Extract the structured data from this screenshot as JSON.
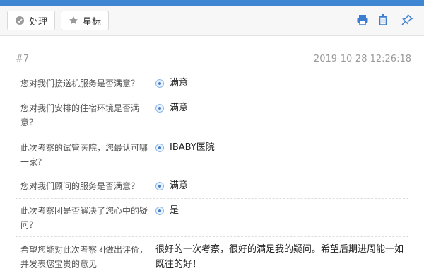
{
  "toolbar": {
    "handle_label": "处理",
    "star_label": "星标"
  },
  "record": {
    "number": "#7",
    "timestamp": "2019-10-28 12:26:18"
  },
  "items": [
    {
      "question": "您对我们接送机服务是否满意？",
      "answer": "满意"
    },
    {
      "question": "您对我们安排的住宿环境是否满意？",
      "answer": "满意"
    },
    {
      "question": "此次考察的试管医院，您最认可哪一家？",
      "answer": "IBABY医院"
    },
    {
      "question": "您对我们顾问的服务是否满意？",
      "answer": "满意"
    },
    {
      "question": "此次考察团是否解决了您心中的疑问？",
      "answer": "是"
    },
    {
      "question": "希望您能对此次考察团做出评价，并发表您宝贵的意见",
      "answer": "很好的一次考察，很好的满足我的疑问。希望后期进周能一如既往的好！"
    }
  ],
  "icons": [
    "check-circle-icon",
    "star-icon",
    "print-icon",
    "trash-icon",
    "pin-icon",
    "radio-selected-icon"
  ],
  "colors": {
    "accent": "#3f86d3",
    "radio": "#3c7dd1"
  }
}
